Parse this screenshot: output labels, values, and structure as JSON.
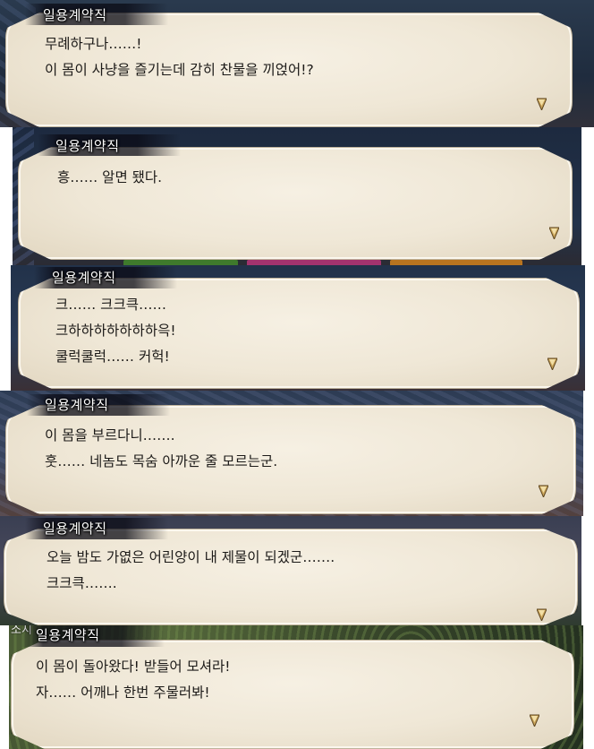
{
  "panels": [
    {
      "speaker": "일용계약직",
      "lines": [
        "무례하구나……!",
        "이 몸이 사냥을 즐기는데 감히 찬물을 끼얹어!?"
      ]
    },
    {
      "speaker": "일용계약직",
      "lines": [
        "흥…… 알면 됐다."
      ]
    },
    {
      "speaker": "일용계약직",
      "lines": [
        "크…… 크크큭……",
        "크하하하하하하하윽!",
        "쿨럭쿨럭…… 커헉!"
      ]
    },
    {
      "speaker": "일용계약직",
      "lines": [
        "이 몸을 부르다니…….",
        "훗…… 네놈도 목숨 아까운 줄 모르는군."
      ]
    },
    {
      "speaker": "일용계약직",
      "lines": [
        "오늘 밤도 가엾은 어린양이 내 제물이 되겠군…….",
        "크크큭……."
      ]
    },
    {
      "speaker": "일용계약직",
      "background_tag": "소지",
      "lines": [
        "이 몸이 돌아왔다! 받들어 모셔라!",
        "자…… 어깨나 한번 주물러봐!"
      ]
    }
  ],
  "icons": {
    "advance": "advance-cursor-icon"
  },
  "colors": {
    "bubble": "#efe7d6",
    "text": "#1c1a18",
    "speaker": "#ffffff",
    "cursor": "#c9a45a"
  }
}
